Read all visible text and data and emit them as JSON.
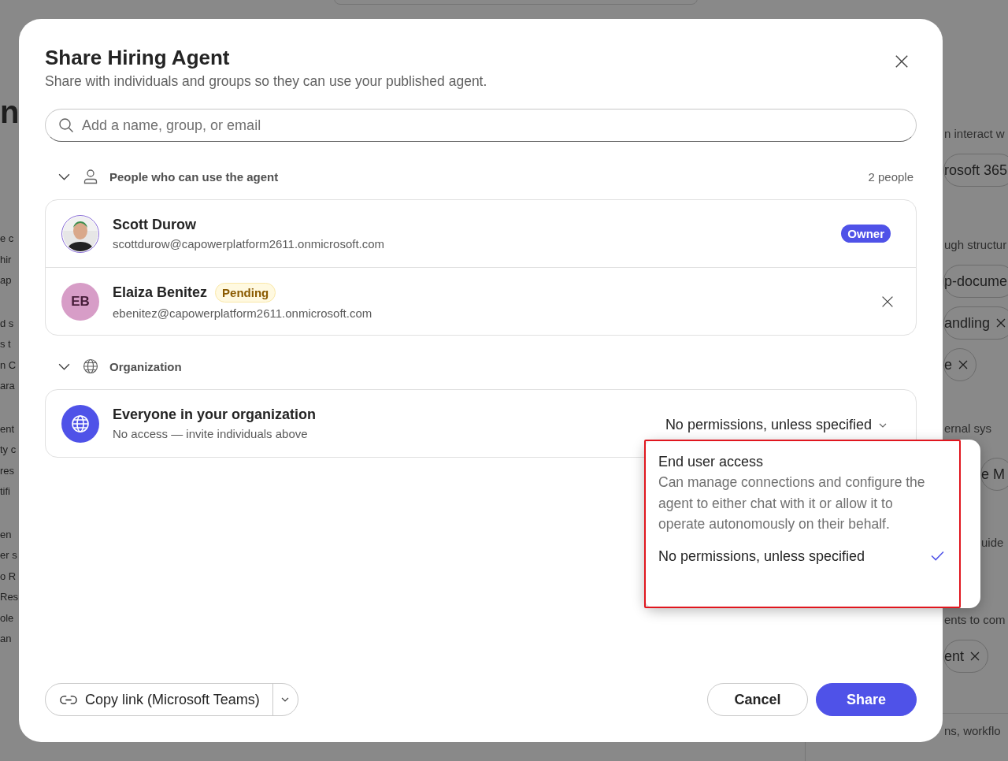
{
  "background": {
    "left_paragraphs": [
      [
        "n"
      ],
      [
        "e c",
        "hir",
        "ap"
      ],
      [
        "d s",
        "s t",
        "n C",
        "ara"
      ],
      [
        "ent",
        "ty c",
        "res",
        "tifi"
      ],
      [
        "en",
        "er s",
        "o R",
        "Res",
        "ole",
        "an"
      ]
    ],
    "right_sections": [
      {
        "label": "n interact w",
        "chips": [
          {
            "text": "rosoft 365"
          }
        ]
      },
      {
        "label": "ugh structur",
        "chips": [
          {
            "text": "p-docume"
          },
          {
            "text": "andling",
            "removable": true
          },
          {
            "text": "e",
            "removable": true
          }
        ]
      },
      {
        "label": "ernal sys",
        "chips": [
          {
            "text": "e M"
          }
        ]
      },
      {
        "label": "uide"
      },
      {
        "label": "ents to com",
        "chips": [
          {
            "text": "ent",
            "removable": true
          }
        ]
      },
      {
        "label": "ns, workflo"
      }
    ]
  },
  "dialog": {
    "title": "Share Hiring Agent",
    "subtitle": "Share with individuals and groups so they can use your published agent.",
    "search": {
      "placeholder": "Add a name, group, or email"
    },
    "people_section": {
      "title": "People who can use the agent",
      "count": "2 people",
      "expanded": true,
      "people": [
        {
          "name": "Scott Durow",
          "email": "scottdurow@capowerplatform2611.onmicrosoft.com",
          "badge": {
            "kind": "owner",
            "text": "Owner"
          },
          "removable": false
        },
        {
          "name": "Elaiza Benitez",
          "email": "ebenitez@capowerplatform2611.onmicrosoft.com",
          "avatar": {
            "kind": "initials",
            "text": "EB"
          },
          "badge": {
            "kind": "pending",
            "text": "Pending"
          },
          "removable": true
        }
      ]
    },
    "org_section": {
      "title": "Organization",
      "expanded": true,
      "name": "Everyone in your organization",
      "description": "No access — invite individuals above",
      "permission": "No permissions, unless specified"
    },
    "permission_menu": {
      "options": [
        {
          "title": "End user access",
          "description": "Can manage connections and configure the agent to either chat with it or allow it to operate autonomously on their behalf.",
          "selected": false
        },
        {
          "title": "No permissions, unless specified",
          "selected": true
        }
      ]
    },
    "copy_link": {
      "label": "Copy link (Microsoft Teams)"
    },
    "buttons": [
      {
        "label": "Cancel",
        "kind": "secondary"
      },
      {
        "label": "Share",
        "kind": "primary"
      }
    ]
  }
}
